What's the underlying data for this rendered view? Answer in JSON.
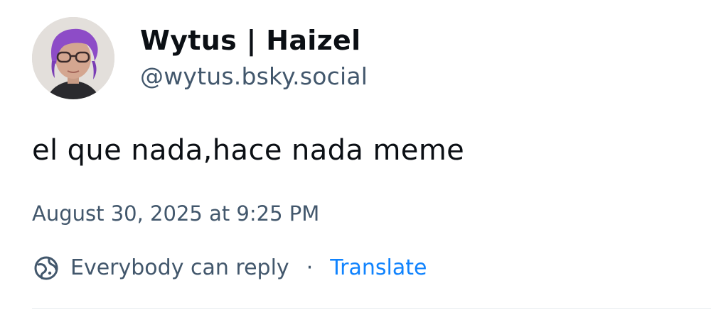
{
  "post": {
    "author": {
      "display_name": "Wytus | Haizel",
      "handle": "@wytus.bsky.social",
      "avatar_icon": "avatar-photo"
    },
    "text": "el que nada,hace nada meme",
    "timestamp": "August 30, 2025 at 9:25 PM",
    "reply_setting": "Everybody can reply",
    "separator": "·",
    "translate_label": "Translate",
    "colors": {
      "primary_text": "#0b0f14",
      "secondary_text": "#42576c",
      "link": "#1083fe"
    }
  }
}
